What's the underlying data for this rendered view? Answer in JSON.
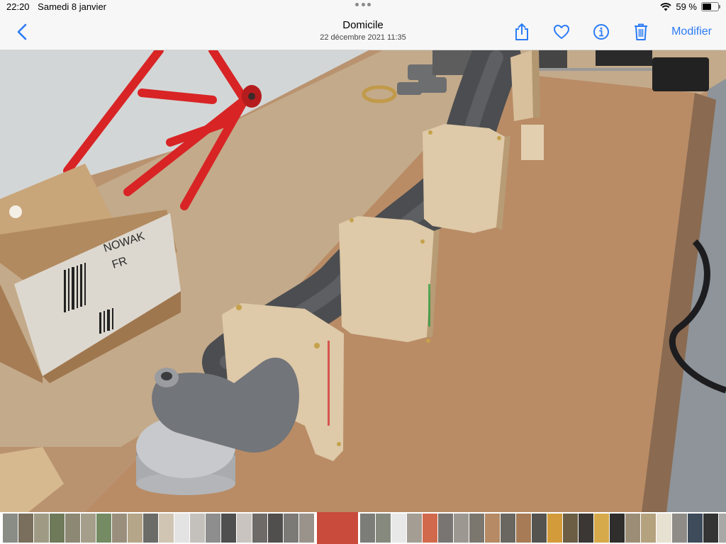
{
  "status_bar": {
    "time": "22:20",
    "date": "Samedi 8 janvier",
    "battery_text": "59 %",
    "battery_level": 0.59,
    "icons": [
      "wifi-icon",
      "battery-icon"
    ]
  },
  "nav": {
    "title": "Domicile",
    "subtitle": "22 décembre 2021  11:35",
    "edit_label": "Modifier",
    "accent_color": "#2a7bf6",
    "icons": [
      "back-chevron-icon",
      "share-icon",
      "heart-icon",
      "info-icon",
      "trash-icon"
    ]
  },
  "photo": {
    "box_label": "NOWAK\nFR",
    "box_label_line1": "NOWAK",
    "box_label_line2": "FR"
  },
  "thumbnails": {
    "colors": [
      "#8a8d85",
      "#7a6f5c",
      "#9e9a84",
      "#6f7a5a",
      "#8c8874",
      "#a59e8a",
      "#748b63",
      "#998f7c",
      "#b5a589",
      "#6b6b67",
      "#d0c4b3",
      "#e3e3e3",
      "#c4c0bb",
      "#8e8e8e",
      "#4f4f4f",
      "#c9c4bf",
      "#6d6a67",
      "#514f4d",
      "#7b7a77",
      "#9a938c",
      "#c94b3c",
      "#7c7d78",
      "#86897e",
      "#e8e8e8",
      "#a39d94",
      "#d16a4c",
      "#787572",
      "#9c9891",
      "#7b776f",
      "#b58a64",
      "#6a6761",
      "#a67b56",
      "#555350",
      "#d39b3a",
      "#6b5e45",
      "#3a3734",
      "#d6a94a",
      "#2f2e2c",
      "#9c8e76",
      "#b4a17d",
      "#e7e1d2",
      "#8f8c88",
      "#3e4b5a",
      "#343434",
      "#a9a8a6",
      "#dcdad5",
      "#545454",
      "#2c2b29",
      "#ceccc7",
      "#3b3a38",
      "#b7b5b1",
      "#d9d8d4",
      "#6f6d69",
      "#262624",
      "#a8a7a3",
      "#4a4a48"
    ],
    "current_index": 20
  }
}
